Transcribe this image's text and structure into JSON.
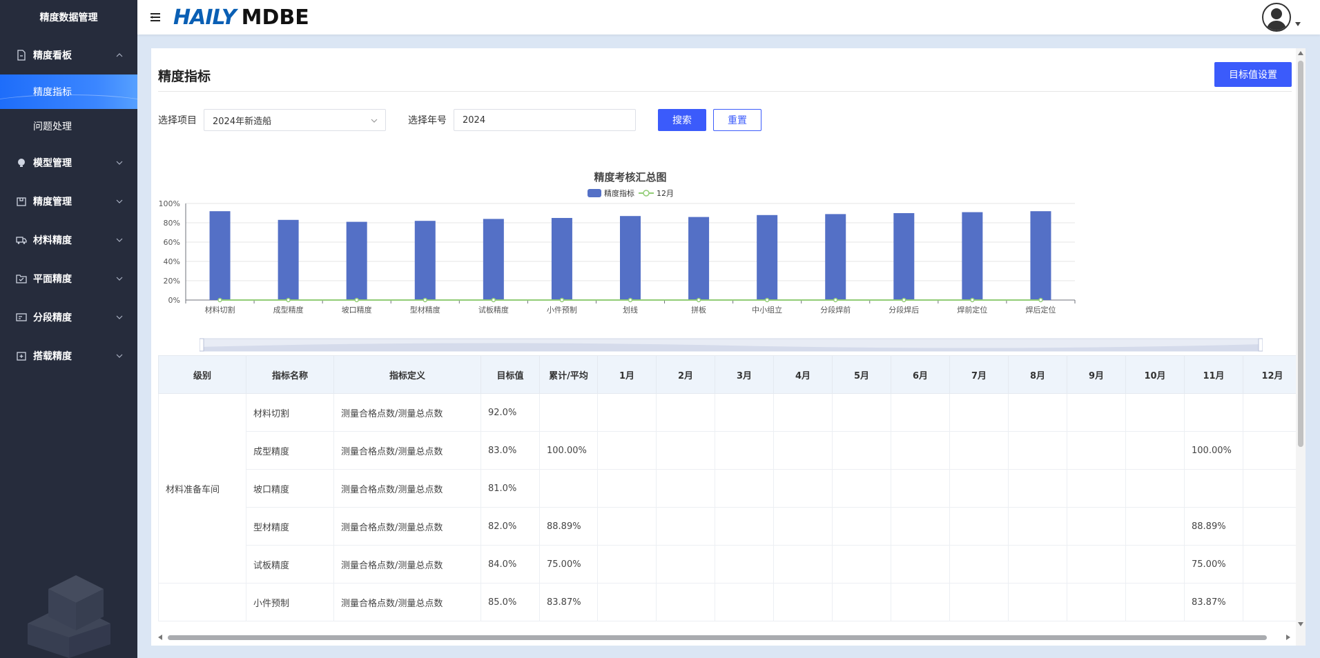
{
  "sidebar": {
    "title": "精度数据管理",
    "menu": [
      {
        "label": "精度看板",
        "icon": "document-icon",
        "expanded": true,
        "children": [
          {
            "label": "精度指标",
            "active": true
          },
          {
            "label": "问题处理",
            "active": false
          }
        ]
      },
      {
        "label": "模型管理",
        "icon": "bulb-icon",
        "expanded": false
      },
      {
        "label": "精度管理",
        "icon": "package-icon",
        "expanded": false
      },
      {
        "label": "材料精度",
        "icon": "truck-icon",
        "expanded": false
      },
      {
        "label": "平面精度",
        "icon": "folder-check-icon",
        "expanded": false
      },
      {
        "label": "分段精度",
        "icon": "card-icon",
        "expanded": false
      },
      {
        "label": "搭载精度",
        "icon": "box-plus-icon",
        "expanded": false
      }
    ]
  },
  "header": {
    "logo_left": "HAILY",
    "logo_right": "MDBE"
  },
  "page": {
    "title": "精度指标",
    "target_button": "目标值设置",
    "filters": {
      "project_label": "选择项目",
      "project_value": "2024年新造船",
      "year_label": "选择年号",
      "year_value": "2024",
      "search_button": "搜索",
      "reset_button": "重置"
    }
  },
  "chart_data": {
    "type": "bar",
    "title": "精度考核汇总图",
    "categories": [
      "材料切割",
      "成型精度",
      "坡口精度",
      "型材精度",
      "试板精度",
      "小件预制",
      "划线",
      "拼板",
      "中小组立",
      "分段焊前",
      "分段焊后",
      "焊前定位",
      "焊后定位"
    ],
    "series": [
      {
        "name": "精度指标",
        "type": "bar",
        "color": "#5470c6",
        "values": [
          92,
          83,
          81,
          82,
          84,
          85,
          87,
          86,
          88,
          89,
          90,
          91,
          92
        ]
      },
      {
        "name": "12月",
        "type": "line",
        "color": "#91cc75",
        "values": [
          0,
          0,
          0,
          0,
          0,
          0,
          0,
          0,
          0,
          0,
          0,
          0,
          0
        ]
      }
    ],
    "ylim": [
      0,
      100
    ],
    "yticks": [
      "0%",
      "20%",
      "40%",
      "60%",
      "80%",
      "100%"
    ],
    "grid": true,
    "legend_position": "top-center"
  },
  "table": {
    "columns": [
      "级别",
      "指标名称",
      "指标定义",
      "目标值",
      "累计/平均",
      "1月",
      "2月",
      "3月",
      "4月",
      "5月",
      "6月",
      "7月",
      "8月",
      "9月",
      "10月",
      "11月",
      "12月"
    ],
    "groups": [
      {
        "level": "材料准备车间",
        "rows": [
          {
            "name": "材料切割",
            "definition": "测量合格点数/测量总点数",
            "target": "92.0%",
            "cumulative": "",
            "nov": "",
            "dec": ""
          },
          {
            "name": "成型精度",
            "definition": "测量合格点数/测量总点数",
            "target": "83.0%",
            "cumulative": "100.00%",
            "nov": "100.00%",
            "dec": ""
          },
          {
            "name": "坡口精度",
            "definition": "测量合格点数/测量总点数",
            "target": "81.0%",
            "cumulative": "",
            "nov": "",
            "dec": ""
          },
          {
            "name": "型材精度",
            "definition": "测量合格点数/测量总点数",
            "target": "82.0%",
            "cumulative": "88.89%",
            "nov": "88.89%",
            "dec": ""
          },
          {
            "name": "试板精度",
            "definition": "测量合格点数/测量总点数",
            "target": "84.0%",
            "cumulative": "75.00%",
            "nov": "75.00%",
            "dec": ""
          }
        ]
      },
      {
        "level": "",
        "rows": [
          {
            "name": "小件预制",
            "definition": "测量合格点数/测量总点数",
            "target": "85.0%",
            "cumulative": "83.87%",
            "nov": "83.87%",
            "dec": ""
          }
        ]
      }
    ]
  }
}
